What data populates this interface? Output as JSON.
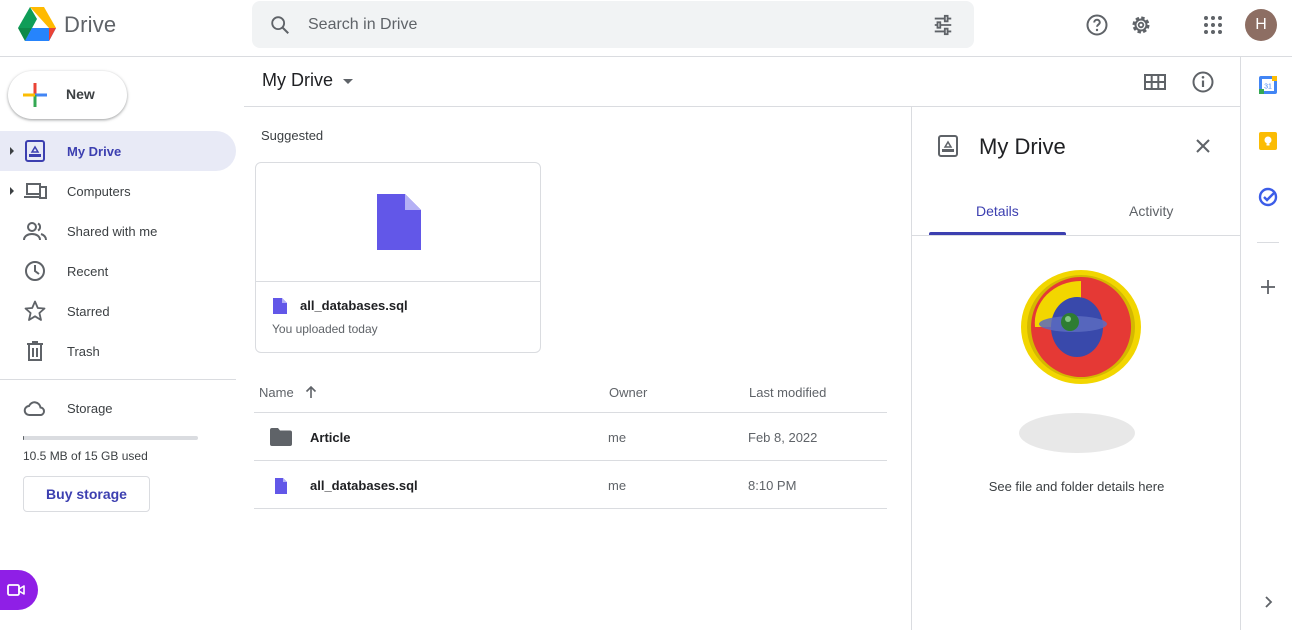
{
  "app": {
    "brand": "Drive",
    "search_placeholder": "Search in Drive",
    "avatar_letter": "H"
  },
  "sidebar": {
    "new_label": "New",
    "items": [
      {
        "label": "My Drive",
        "icon": "my-drive-icon",
        "active": true,
        "expandable": true
      },
      {
        "label": "Computers",
        "icon": "computers-icon",
        "active": false,
        "expandable": true
      },
      {
        "label": "Shared with me",
        "icon": "shared-icon",
        "active": false,
        "expandable": false
      },
      {
        "label": "Recent",
        "icon": "clock-icon",
        "active": false,
        "expandable": false
      },
      {
        "label": "Starred",
        "icon": "star-icon",
        "active": false,
        "expandable": false
      },
      {
        "label": "Trash",
        "icon": "trash-icon",
        "active": false,
        "expandable": false
      }
    ],
    "storage_label": "Storage",
    "storage_used_text": "10.5 MB of 15 GB used",
    "storage_used_fraction": 0.0007,
    "buy_storage_label": "Buy storage"
  },
  "main": {
    "title": "My Drive",
    "suggested_label": "Suggested",
    "suggested_card": {
      "name": "all_databases.sql",
      "subtitle": "You uploaded today"
    },
    "columns": {
      "name": "Name",
      "owner": "Owner",
      "modified": "Last modified"
    },
    "rows": [
      {
        "name": "Article",
        "type": "folder",
        "owner": "me",
        "modified": "Feb 8, 2022"
      },
      {
        "name": "all_databases.sql",
        "type": "file",
        "owner": "me",
        "modified": "8:10 PM"
      }
    ]
  },
  "details_panel": {
    "title": "My Drive",
    "tabs": [
      "Details",
      "Activity"
    ],
    "active_tab": "Details",
    "hint": "See file and folder details here"
  },
  "colors": {
    "accent": "#3c3fb0",
    "file_icon": "#6257e8",
    "active_nav_bg": "#e8eaf6",
    "meet_fab": "#8f1fe6"
  }
}
